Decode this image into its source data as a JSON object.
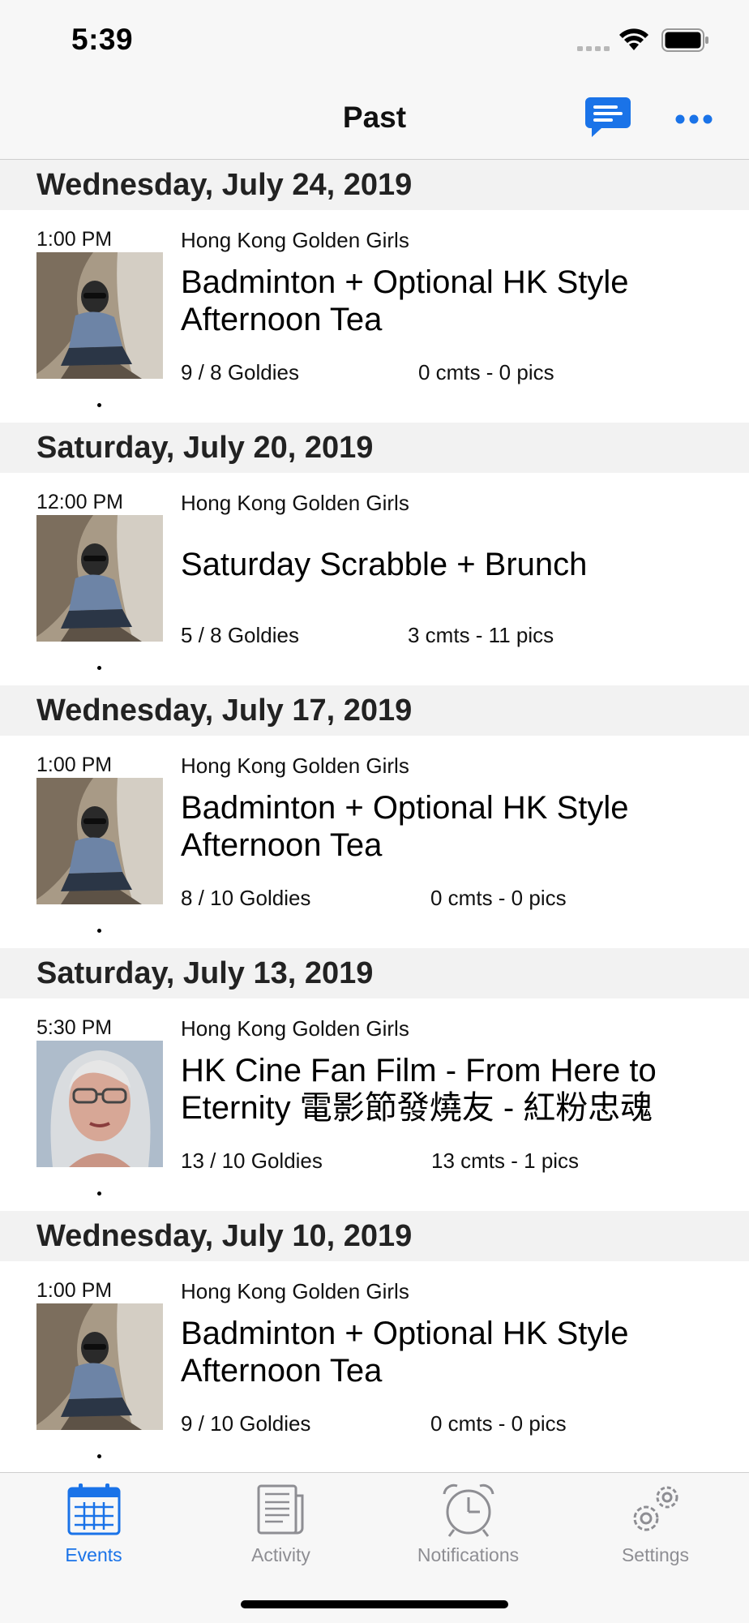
{
  "status_bar": {
    "time": "5:39"
  },
  "nav": {
    "title": "Past"
  },
  "colors": {
    "accent": "#1a73e8",
    "tab_inactive": "#8e8e93",
    "section_bg": "#f2f2f2"
  },
  "events": [
    {
      "date": "Wednesday, July 24, 2019",
      "time": "1:00 PM",
      "group": "Hong Kong Golden Girls",
      "title": "Badminton + Optional HK Style Afternoon Tea",
      "attendance": "9 / 8 Goldies",
      "stats": "0 cmts - 0 pics",
      "avatar": "hiker"
    },
    {
      "date": "Saturday, July 20, 2019",
      "time": "12:00 PM",
      "group": "Hong Kong Golden Girls",
      "title": "Saturday Scrabble + Brunch",
      "attendance": "5 / 8 Goldies",
      "stats": "3 cmts - 11 pics",
      "avatar": "hiker"
    },
    {
      "date": "Wednesday, July 17, 2019",
      "time": "1:00 PM",
      "group": "Hong Kong Golden Girls",
      "title": "Badminton + Optional HK Style Afternoon Tea",
      "attendance": "8 / 10 Goldies",
      "stats": "0 cmts - 0 pics",
      "avatar": "hiker"
    },
    {
      "date": "Saturday, July 13, 2019",
      "time": "5:30 PM",
      "group": "Hong Kong Golden Girls",
      "title": "HK Cine Fan Film - From Here to Eternity  電影節發燒友 - 紅粉忠魂",
      "attendance": "13 / 10 Goldies",
      "stats": "13 cmts - 1 pics",
      "avatar": "portrait"
    },
    {
      "date": "Wednesday, July 10, 2019",
      "time": "1:00 PM",
      "group": "Hong Kong Golden Girls",
      "title": "Badminton + Optional HK Style Afternoon Tea",
      "attendance": "9 / 10 Goldies",
      "stats": "0 cmts - 0 pics",
      "avatar": "hiker"
    }
  ],
  "tabs": [
    {
      "label": "Events",
      "icon": "calendar-icon",
      "active": true
    },
    {
      "label": "Activity",
      "icon": "newspaper-icon",
      "active": false
    },
    {
      "label": "Notifications",
      "icon": "alarm-clock-icon",
      "active": false
    },
    {
      "label": "Settings",
      "icon": "gears-icon",
      "active": false
    }
  ]
}
